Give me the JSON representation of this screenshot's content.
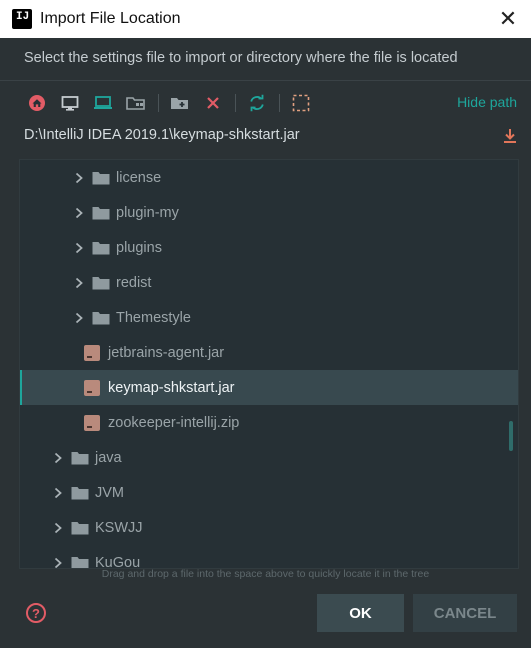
{
  "window": {
    "app_icon_text": "IJ",
    "title": "Import File Location",
    "close_glyph": "✕"
  },
  "description": "Select the settings file to import or directory where the file is located",
  "toolbar": {
    "buttons": [
      "home-icon",
      "desktop-icon",
      "project-icon",
      "module-icon",
      "new-folder-icon",
      "delete-icon",
      "refresh-icon",
      "show-hidden-icon"
    ],
    "hide_path_label": "Hide path"
  },
  "path": {
    "value": "D:\\IntelliJ IDEA 2019.1\\keymap-shkstart.jar"
  },
  "tree": {
    "rows": [
      {
        "label": "license",
        "kind": "folder",
        "expandable": true
      },
      {
        "label": "plugin-my",
        "kind": "folder",
        "expandable": true
      },
      {
        "label": "plugins",
        "kind": "folder",
        "expandable": true
      },
      {
        "label": "redist",
        "kind": "folder",
        "expandable": true
      },
      {
        "label": "Themestyle",
        "kind": "folder",
        "expandable": true
      },
      {
        "label": "jetbrains-agent.jar",
        "kind": "jar",
        "expandable": false
      },
      {
        "label": "keymap-shkstart.jar",
        "kind": "jar",
        "expandable": false,
        "selected": true
      },
      {
        "label": "zookeeper-intellij.zip",
        "kind": "zip",
        "expandable": false
      },
      {
        "label": "java",
        "kind": "folder",
        "expandable": true
      },
      {
        "label": "JVM",
        "kind": "folder",
        "expandable": true
      },
      {
        "label": "KSWJJ",
        "kind": "folder",
        "expandable": true
      },
      {
        "label": "KuGou",
        "kind": "folder",
        "expandable": true
      }
    ]
  },
  "hint": "Drag and drop a file into the space above to quickly locate it in the tree",
  "footer": {
    "help_glyph": "?",
    "ok_label": "OK",
    "cancel_label": "CANCEL"
  },
  "colors": {
    "accent": "#1ea69c",
    "background": "#2b3235",
    "tree_background": "#263035",
    "selection": "#38494f",
    "danger": "#e25c66"
  }
}
